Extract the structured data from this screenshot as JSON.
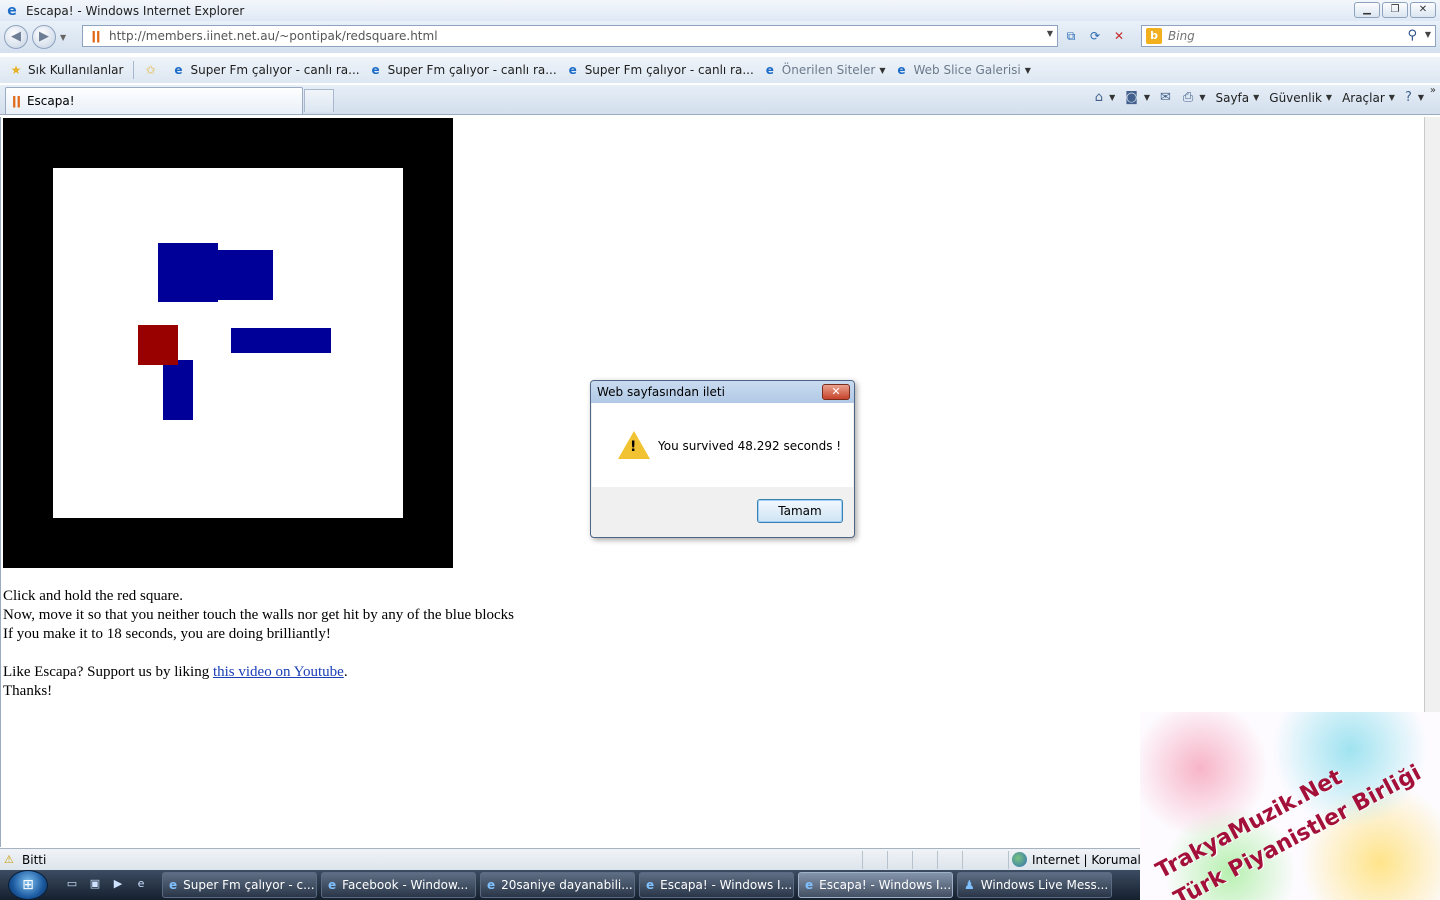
{
  "window": {
    "title": "Escapa! - Windows Internet Explorer"
  },
  "address": {
    "url": "http://members.iinet.net.au/~pontipak/redsquare.html"
  },
  "search": {
    "placeholder": "Bing"
  },
  "favorites": {
    "main": "Sık Kullanılanlar",
    "items": [
      {
        "label": "Super Fm çalıyor - canlı ra..."
      },
      {
        "label": "Super Fm çalıyor - canlı ra..."
      },
      {
        "label": "Super Fm çalıyor - canlı ra..."
      },
      {
        "label": "Önerilen Siteler"
      },
      {
        "label": "Web Slice Galerisi"
      }
    ]
  },
  "tab": {
    "label": "Escapa!"
  },
  "commands": {
    "page": "Sayfa",
    "security": "Güvenlik",
    "tools": "Araçlar"
  },
  "game": {
    "colors": {
      "border": "#000000",
      "field": "#ffffff",
      "blue": "#000099",
      "red": "#990000"
    }
  },
  "page": {
    "line1": "Click and hold the red square.",
    "line2": "Now, move it so that you neither touch the walls nor get hit by any of the blue blocks",
    "line3": "If you make it to 18 seconds, you are doing brilliantly!",
    "like_prefix": "Like Escapa? Support us by liking ",
    "like_link": "this video on Youtube",
    "like_suffix": ".",
    "thanks": "Thanks!"
  },
  "dialog": {
    "title": "Web sayfasından ileti",
    "message": "You survived 48.292 seconds !",
    "ok": "Tamam"
  },
  "status": {
    "text": "Bitti",
    "zone": "Internet | Korumalı M"
  },
  "taskbar": {
    "tasks": [
      {
        "label": "Super Fm çalıyor - c..."
      },
      {
        "label": "Facebook - Window..."
      },
      {
        "label": "20saniye dayanabili..."
      },
      {
        "label": "Escapa! - Windows I..."
      },
      {
        "label": "Escapa! - Windows I..."
      },
      {
        "label": "Windows Live Mess..."
      }
    ]
  },
  "watermark": {
    "line1": "TrakyaMuzik.Net",
    "line2": "Türk Piyanistler Birliği"
  }
}
